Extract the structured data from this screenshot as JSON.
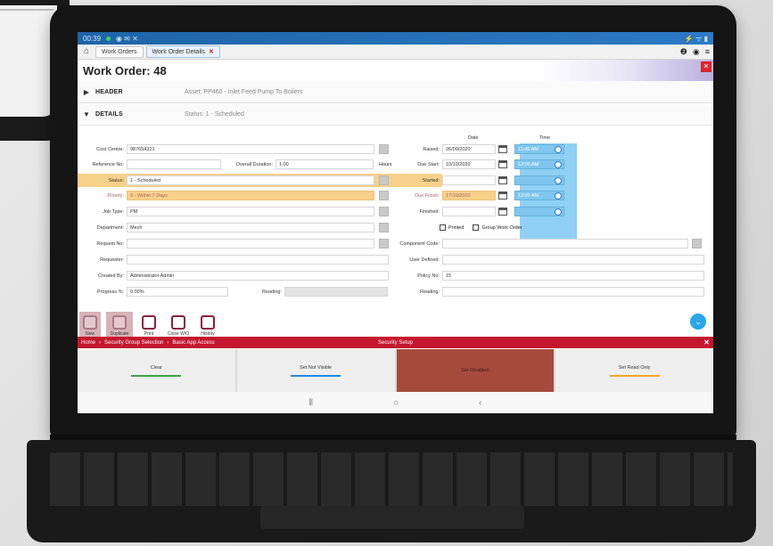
{
  "status_bar": {
    "time": "00:39",
    "left_icons": "◉ ✉ ✕",
    "right_icons": "⚡ ᯤ ▮"
  },
  "tabs": [
    {
      "label": "Work Orders",
      "closable": false
    },
    {
      "label": "Work Order Details",
      "closable": true,
      "close_glyph": "✕"
    }
  ],
  "tab_icons": {
    "help": "❷",
    "account": "◉",
    "menu": "≡"
  },
  "title": "Work Order: 48",
  "title_close": "✕",
  "sections": [
    {
      "name": "HEADER",
      "info": "Asset: PP460 - Inlet Feed Pump To Boilers",
      "expanded": false
    },
    {
      "name": "DETAILS",
      "info": "Status: 1 - Scheduled",
      "expanded": true
    }
  ],
  "details": {
    "date_col_header": "Date",
    "time_col_header": "Time",
    "left": [
      {
        "label": "Cost Centre:",
        "value": "987654321",
        "lookup": true
      },
      {
        "label": "Reference No:",
        "value": "",
        "overall_label": "Overall Duration:",
        "overall_value": "1:00",
        "unit": "Hours"
      },
      {
        "label": "Status:",
        "value": "1 - Scheduled",
        "lookup": true
      },
      {
        "label": "Priority:",
        "value": "3 - Within 7 Days",
        "lookup": true,
        "highlight": true
      },
      {
        "label": "Job Type:",
        "value": "PM",
        "lookup": true
      },
      {
        "label": "Department:",
        "value": "Mech",
        "lookup": true
      },
      {
        "label": "Request No:",
        "value": "",
        "lookup": true
      },
      {
        "label": "Requester:",
        "value": ""
      },
      {
        "label": "Created By:",
        "value": "Administrator Admin"
      },
      {
        "label": "Progress %:",
        "value": "0.00%",
        "reading_label": "Reading:",
        "reading_value": ""
      }
    ],
    "right": [
      {
        "label": "Raised:",
        "date": "26/09/2020",
        "time": "11:45 AM"
      },
      {
        "label": "Due Start:",
        "date": "10/10/2020",
        "time": "12:00 AM"
      },
      {
        "label": "Started:",
        "date": "",
        "time": ""
      },
      {
        "label": "Due Finish:",
        "date": "17/10/2020",
        "time": "12:00 AM",
        "highlight": true
      },
      {
        "label": "Finished:",
        "date": "",
        "time": ""
      }
    ],
    "checkboxes": [
      {
        "label": "Printed",
        "checked": false
      },
      {
        "label": "Group Work Order",
        "checked": false
      }
    ],
    "right_extra": [
      {
        "label": "Component Code:",
        "value": ""
      },
      {
        "label": "User Defined:",
        "value": ""
      },
      {
        "label": "Policy No:",
        "value": "15"
      },
      {
        "label": "Reading:",
        "value": ""
      }
    ]
  },
  "toolbar": [
    {
      "label": "New",
      "icon": "new-icon",
      "enabled": false
    },
    {
      "label": "Duplicate",
      "icon": "duplicate-icon",
      "enabled": false
    },
    {
      "label": "Print",
      "icon": "print-icon",
      "enabled": true
    },
    {
      "label": "Close W/O",
      "icon": "close-wo-icon",
      "enabled": true
    },
    {
      "label": "History",
      "icon": "history-icon",
      "enabled": true
    }
  ],
  "fab_glyph": "⌄",
  "breadcrumb": {
    "items": [
      "Home",
      "Security Group Selection",
      "Basic App Access"
    ],
    "separator": "‹",
    "center_title": "Security Setup",
    "close": "✕"
  },
  "security_actions": [
    {
      "label": "Clear",
      "color": "#43a047",
      "selected": false
    },
    {
      "label": "Set Not Visible",
      "color": "#1e88e5",
      "selected": false
    },
    {
      "label": "Set Disabled",
      "color": "#a64a3d",
      "selected": true
    },
    {
      "label": "Set Read Only",
      "color": "#f5a623",
      "selected": false
    }
  ],
  "nav": {
    "recent": "⦀",
    "home": "○",
    "back": "‹"
  },
  "colors": {
    "status_bar": "#1e64a8",
    "accent_red": "#c4162f",
    "highlight": "#f7d08a",
    "time_field": "#7fc6ef"
  }
}
